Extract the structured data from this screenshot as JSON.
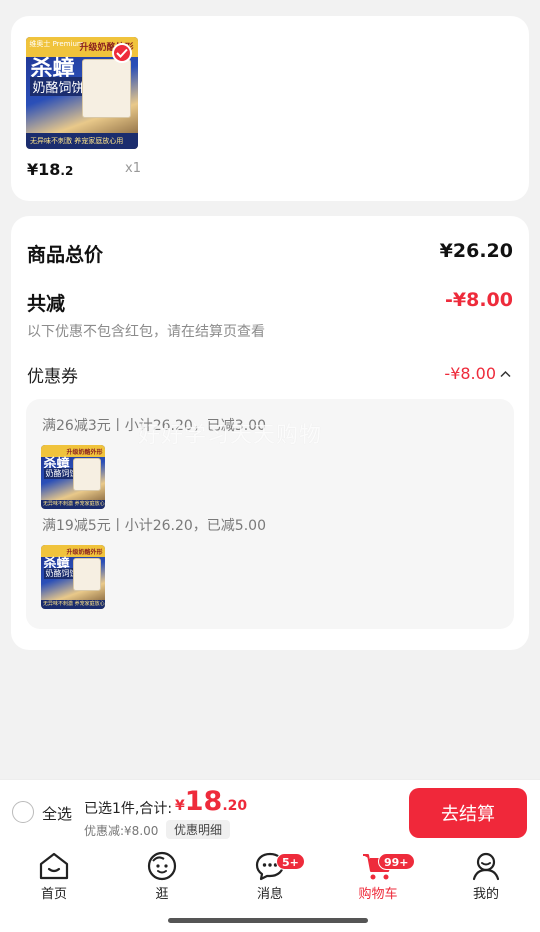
{
  "item": {
    "thumb": {
      "logo": "维奥士 Premium",
      "band_label": "升级奶酪外形",
      "big": "杀蟑",
      "sub": "奶酪饲饼",
      "foot": "无异味不刺激 养宠家庭放心用"
    },
    "price_currency": "¥",
    "price_int": "18",
    "price_dec": ".2",
    "quantity": "x1"
  },
  "summary": {
    "total_label": "商品总价",
    "total_value": "¥26.20",
    "discount_label": "共减",
    "discount_value": "-¥8.00",
    "discount_note": "以下优惠不包含红包，请在结算页查看",
    "coupon_label": "优惠券",
    "coupon_value": "-¥8.00",
    "coupons": [
      {
        "line": "满26减3元丨小计26.20，已减3.00"
      },
      {
        "line": "满19减5元丨小计26.20，已减5.00"
      }
    ]
  },
  "watermark": "好好学习天天购物",
  "checkout": {
    "select_all": "全选",
    "selected_count": "已选1件,合计:",
    "total_currency": "¥",
    "total_int": "18",
    "total_dec": ".20",
    "discount": "优惠减:¥8.00",
    "detail_button": "优惠明细",
    "checkout_button": "去结算"
  },
  "tabs": [
    {
      "label": "首页",
      "icon": "home-icon",
      "badge": ""
    },
    {
      "label": "逛",
      "icon": "face-icon",
      "badge": ""
    },
    {
      "label": "消息",
      "icon": "message-icon",
      "badge": "5+"
    },
    {
      "label": "购物车",
      "icon": "cart-icon",
      "badge": "99+"
    },
    {
      "label": "我的",
      "icon": "profile-icon",
      "badge": ""
    }
  ],
  "colors": {
    "accent": "#ee2b3b",
    "background": "#f2f2f2"
  }
}
